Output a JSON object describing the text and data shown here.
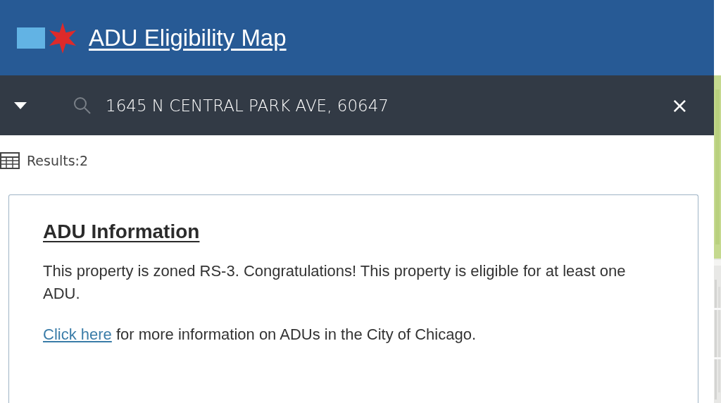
{
  "header": {
    "title": "ADU Eligibility Map"
  },
  "search": {
    "value": "1645 N CENTRAL PARK AVE, 60647",
    "clear": "×"
  },
  "results": {
    "label": "Results:2"
  },
  "card": {
    "heading": "ADU Information",
    "paragraph": "This property is zoned RS-3. Congratulations! This property is eligible for at least one ADU.",
    "link": {
      "text": "Click here",
      "rest": " for more information on ADUs in the City of Chicago."
    }
  }
}
